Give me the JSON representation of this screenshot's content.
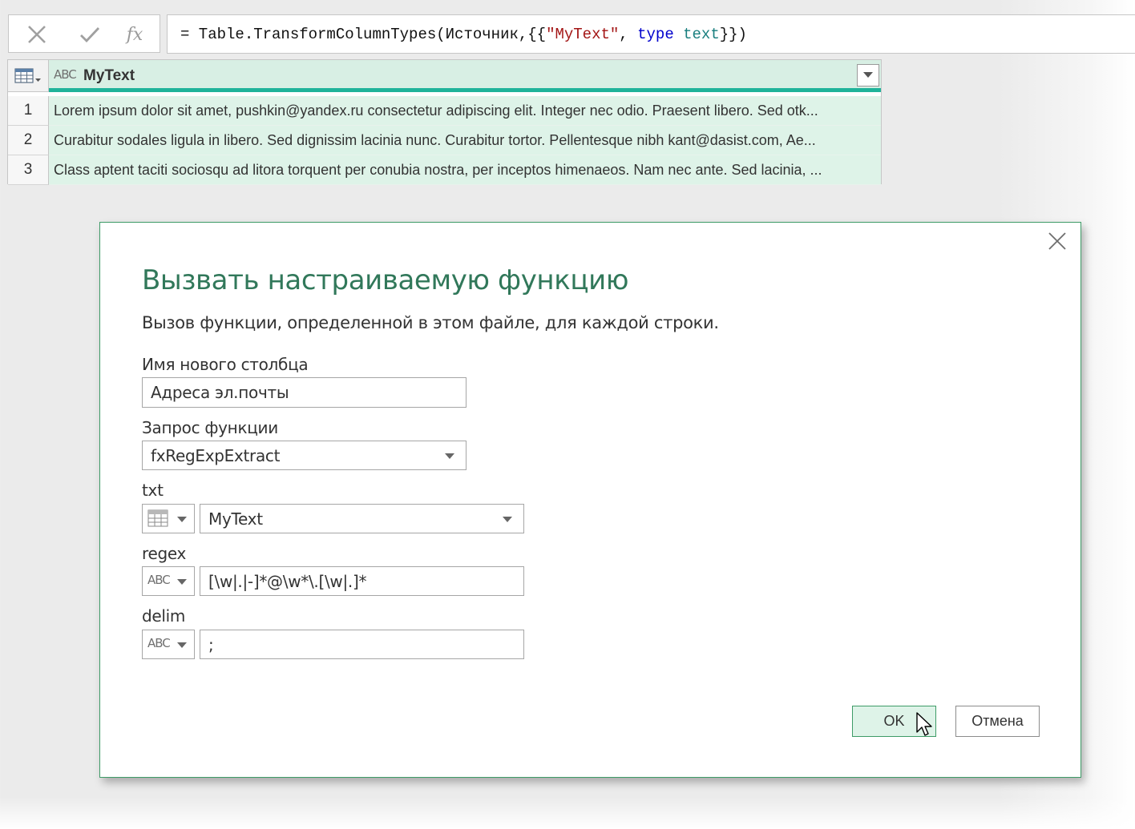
{
  "formula_bar": {
    "fx_label": "fx",
    "formula_parts": {
      "prefix": "= Table.TransformColumnTypes(Источник,{{",
      "column_string": "\"MyText\"",
      "sep": ", ",
      "keyword": "type",
      "space": " ",
      "type_name": "text",
      "suffix": "}})"
    }
  },
  "grid": {
    "column": {
      "type_icon": "ABC",
      "name": "MyText"
    },
    "rows": [
      {
        "index": "1",
        "value": "Lorem ipsum dolor sit amet, pushkin@yandex.ru consectetur adipiscing elit. Integer nec odio. Praesent libero. Sed otk..."
      },
      {
        "index": "2",
        "value": "Curabitur sodales ligula in libero. Sed dignissim lacinia nunc. Curabitur tortor. Pellentesque nibh kant@dasist.com, Ae..."
      },
      {
        "index": "3",
        "value": "Class aptent taciti sociosqu ad litora torquent per conubia nostra, per inceptos himenaeos. Nam nec ante. Sed lacinia, ..."
      }
    ]
  },
  "dialog": {
    "title": "Вызвать настраиваемую функцию",
    "description": "Вызов функции, определенной в этом файле, для каждой строки.",
    "new_column_label": "Имя нового столбца",
    "new_column_value": "Адреса эл.почты",
    "function_query_label": "Запрос функции",
    "function_query_value": "fxRegExpExtract",
    "params": {
      "txt": {
        "label": "txt",
        "value": "MyText",
        "type_icon": "table-icon"
      },
      "regex": {
        "label": "regex",
        "value": "[\\w|.|-]*@\\w*\\.[\\w|.]*",
        "type_icon": "ABC"
      },
      "delim": {
        "label": "delim",
        "value": ";",
        "type_icon": "ABC"
      }
    },
    "ok_label": "OK",
    "cancel_label": "Отмена"
  },
  "colors": {
    "accent_green": "#31785a",
    "header_teal": "#1fb39a",
    "row_bg": "#def3e8"
  }
}
